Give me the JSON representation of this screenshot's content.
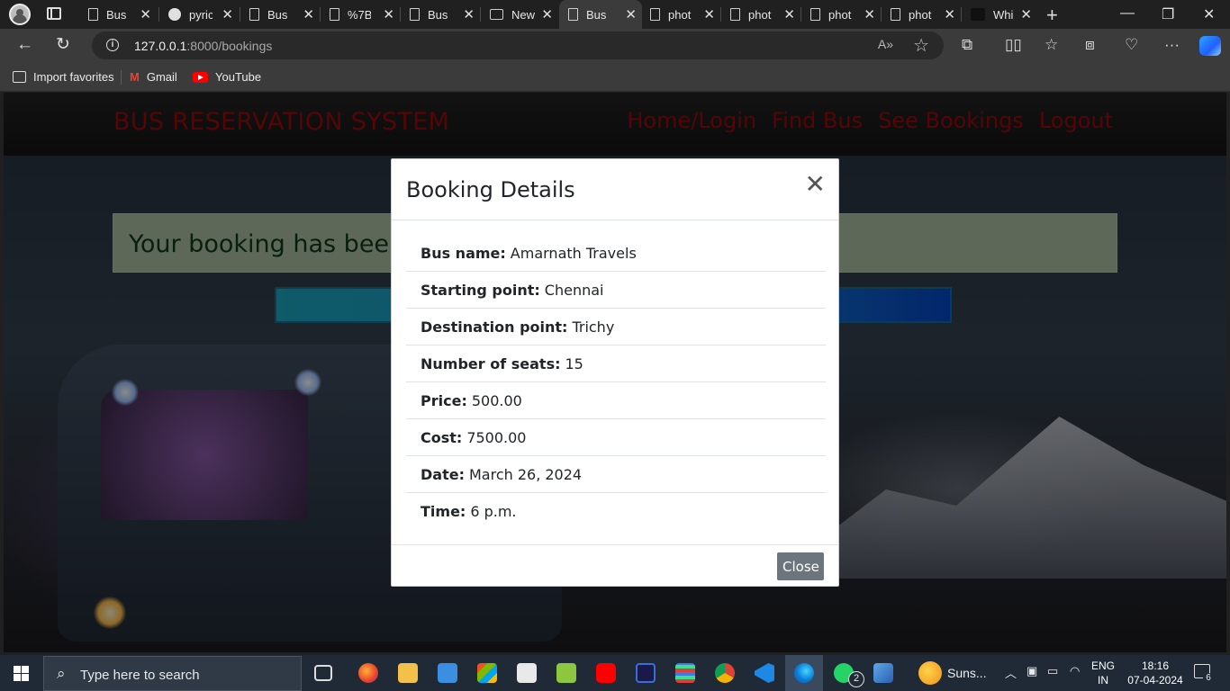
{
  "browser": {
    "tabs": [
      {
        "title": "Bus I",
        "icon": "page-icon"
      },
      {
        "title": "pyric",
        "icon": "github-icon"
      },
      {
        "title": "Bus I",
        "icon": "page-icon"
      },
      {
        "title": "%7B",
        "icon": "page-icon"
      },
      {
        "title": "Bus I",
        "icon": "page-icon"
      },
      {
        "title": "New",
        "icon": "newtab-icon"
      },
      {
        "title": "Bus",
        "icon": "page-icon",
        "active": true
      },
      {
        "title": "phot",
        "icon": "page-icon"
      },
      {
        "title": "phot",
        "icon": "page-icon"
      },
      {
        "title": "phot",
        "icon": "page-icon"
      },
      {
        "title": "phot",
        "icon": "page-icon"
      },
      {
        "title": "Whi",
        "icon": "page-icon"
      }
    ],
    "address": {
      "host": "127.0.0.1",
      "path": ":8000/bookings"
    },
    "favorites": {
      "import": "Import favorites",
      "gmail": "Gmail",
      "youtube": "YouTube"
    }
  },
  "site": {
    "brand": "BUS RESERVATION SYSTEM",
    "nav": {
      "home": "Home/Login",
      "find": "Find Bus",
      "bookings": "See Bookings",
      "logout": "Logout"
    },
    "alert": "Your booking has been",
    "brand_color": "#9b0a0a"
  },
  "modal": {
    "title": "Booking Details",
    "rows": [
      {
        "label": "Bus name:",
        "value": "Amarnath Travels"
      },
      {
        "label": "Starting point:",
        "value": "Chennai"
      },
      {
        "label": "Destination point:",
        "value": "Trichy"
      },
      {
        "label": "Number of seats:",
        "value": "15"
      },
      {
        "label": "Price:",
        "value": "500.00"
      },
      {
        "label": "Cost:",
        "value": "7500.00"
      },
      {
        "label": "Date:",
        "value": "March 26, 2024"
      },
      {
        "label": "Time:",
        "value": "6 p.m."
      }
    ],
    "close_label": "Close"
  },
  "taskbar": {
    "search_placeholder": "Type here to search",
    "weather": "Suns...",
    "whatsapp_badge": "2",
    "lang_line1": "ENG",
    "lang_line2": "IN",
    "time": "18:16",
    "date": "07-04-2024",
    "notification_count": "6"
  }
}
